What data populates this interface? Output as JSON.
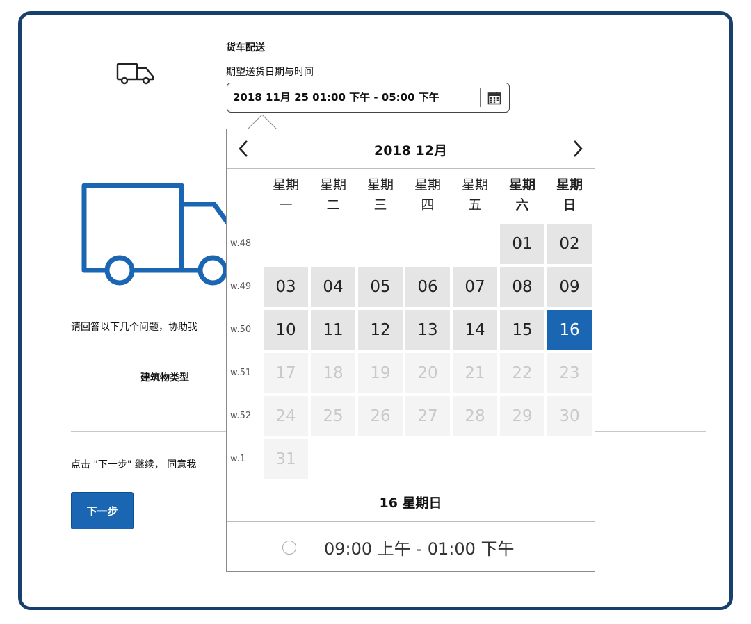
{
  "header": {
    "title": "货车配送",
    "subtitle": "期望送货日期与时间",
    "date_value": "2018 11月 25 01:00 下午 - 05:00 下午"
  },
  "body": {
    "question_text": "请回答以下几个问题，协助我",
    "building_type_label": "建筑物类型",
    "agree_text": "点击 \"下一步\" 继续， 同意我",
    "next_button": "下一步"
  },
  "calendar": {
    "month_title": "2018 12月",
    "weekdays": [
      "星期\n一",
      "星期\n二",
      "星期\n三",
      "星期\n四",
      "星期\n五",
      "星期\n六",
      "星期\n日"
    ],
    "weeks": [
      {
        "label": "w.48",
        "days": [
          "",
          "",
          "",
          "",
          "",
          "01",
          "02"
        ]
      },
      {
        "label": "w.49",
        "days": [
          "03",
          "04",
          "05",
          "06",
          "07",
          "08",
          "09"
        ]
      },
      {
        "label": "w.50",
        "days": [
          "10",
          "11",
          "12",
          "13",
          "14",
          "15",
          "16"
        ]
      },
      {
        "label": "w.51",
        "days": [
          "17",
          "18",
          "19",
          "20",
          "21",
          "22",
          "23"
        ]
      },
      {
        "label": "w.52",
        "days": [
          "24",
          "25",
          "26",
          "27",
          "28",
          "29",
          "30"
        ]
      },
      {
        "label": "w.1",
        "days": [
          "31",
          "",
          "",
          "",
          "",
          "",
          ""
        ]
      }
    ],
    "selected_day": "16",
    "last_enabled_day": "16",
    "selected_label": "16 星期日",
    "time_slot": "09:00 上午 - 01:00 下午"
  },
  "colors": {
    "frame": "#17406d",
    "accent": "#1a66b3",
    "day_bg": "#e5e5e5",
    "disabled_text": "#c9c9c9"
  },
  "icons": [
    "truck-icon",
    "calendar-icon",
    "chevron-left-icon",
    "chevron-right-icon",
    "radio-icon"
  ]
}
